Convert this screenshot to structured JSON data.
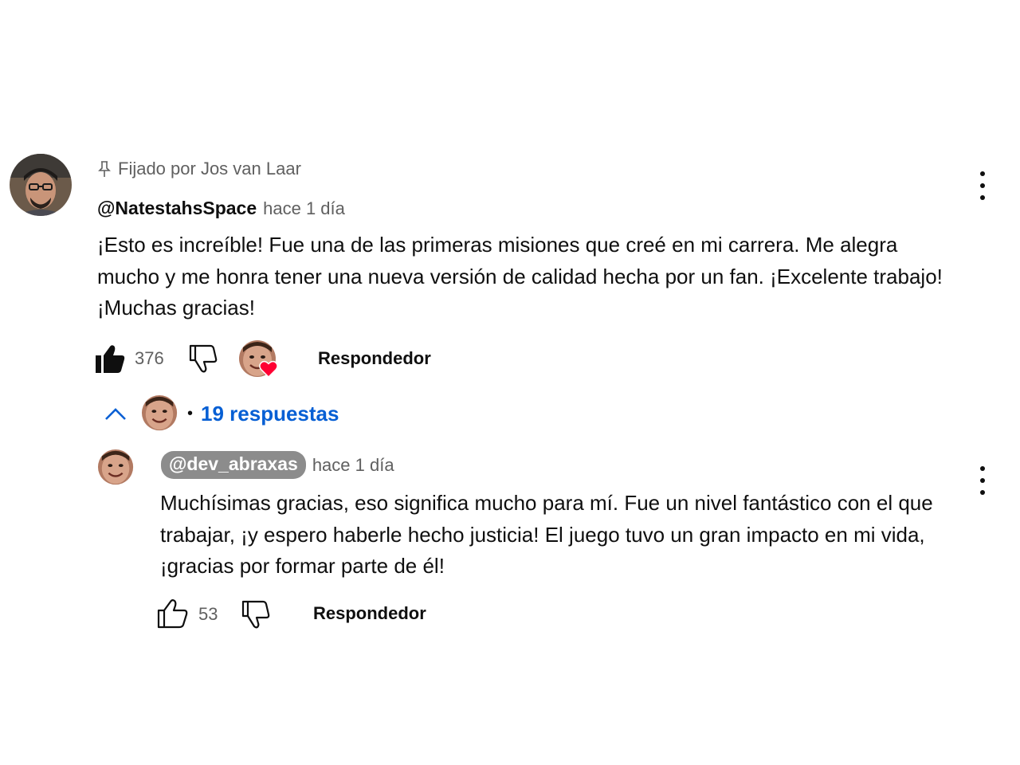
{
  "comment": {
    "pinned_label": "Fijado por Jos van Laar",
    "author": "@NatestahsSpace",
    "time": "hace 1 día",
    "text": "¡Esto es increíble! Fue una de las primeras misiones que creé en mi carrera. Me alegra mucho y me honra tener una nueva versión de calidad hecha por un fan. ¡Excelente trabajo! ¡Muchas gracias!",
    "like_count": "376",
    "reply_label": "Respondedor",
    "icons": [
      "pin-icon",
      "thumb-up-filled-icon",
      "thumb-down-icon",
      "creator-heart-icon",
      "more-vert-icon"
    ]
  },
  "replies_toggle": {
    "separator": "•",
    "count_label": "19 respuestas",
    "accent_color": "#065fd4"
  },
  "reply": {
    "author": "@dev_abraxas",
    "time": "hace 1 día",
    "text": "Muchísimas gracias, eso significa mucho para mí. Fue un nivel fantástico con el que trabajar, ¡y espero haberle hecho justicia! El juego tuvo un gran impacto en mi vida, ¡gracias por formar parte de él!",
    "like_count": "53",
    "reply_label": "Respondedor",
    "icons": [
      "thumb-up-outline-icon",
      "thumb-down-icon",
      "more-vert-icon"
    ]
  },
  "colors": {
    "heart": "#ff0033",
    "secondary_text": "#606060",
    "handle_pill": "#8c8c8c"
  }
}
